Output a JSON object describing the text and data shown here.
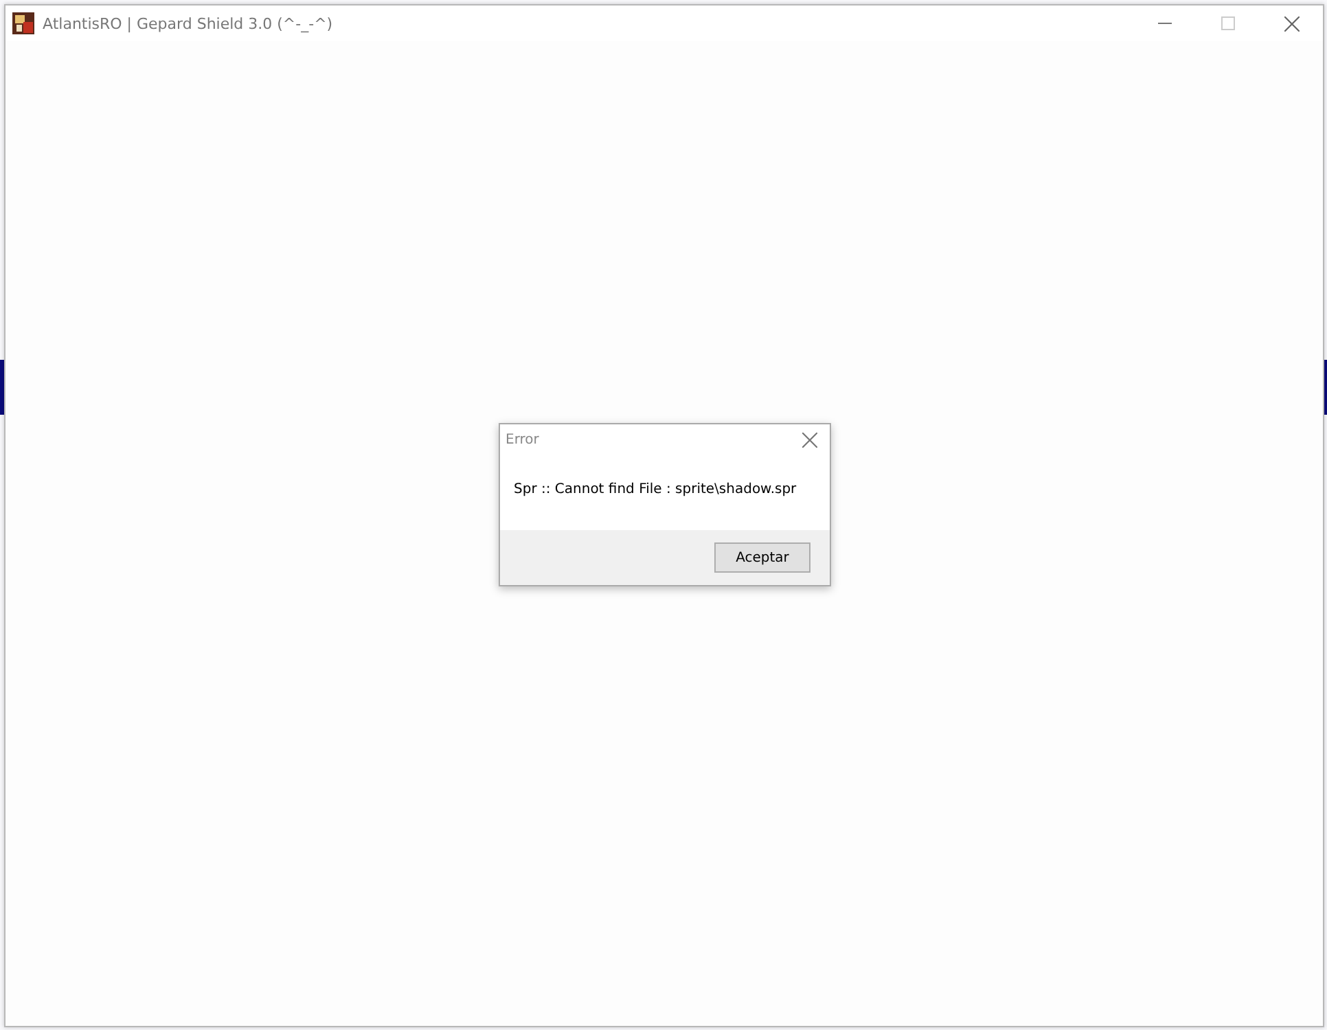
{
  "window": {
    "title": "AtlantisRO | Gepard Shield 3.0 (^-_-^)"
  },
  "dialog": {
    "title": "Error",
    "message": "Spr :: Cannot find File : sprite\\shadow.spr",
    "buttons": [
      "Aceptar"
    ]
  }
}
